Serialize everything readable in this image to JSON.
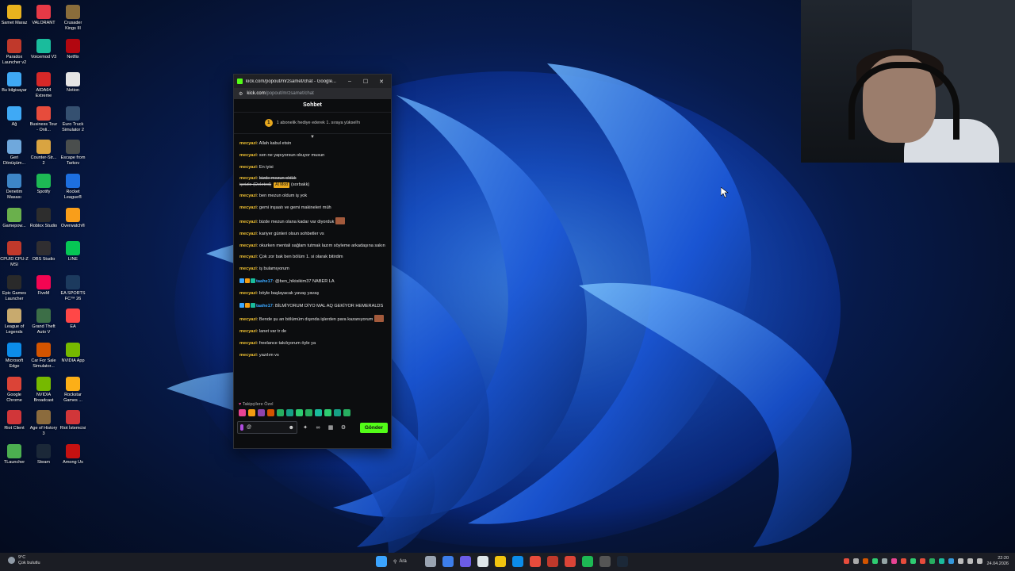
{
  "desktop": {
    "icons": [
      {
        "label": "Samet Maraz",
        "color": "#e8b21e"
      },
      {
        "label": "VALORANT",
        "color": "#e63946"
      },
      {
        "label": "Crusader Kings III",
        "color": "#8a6d3b"
      },
      {
        "label": "Paradox Launcher v2",
        "color": "#c0392b"
      },
      {
        "label": "Voicemod V3",
        "color": "#1abc9c"
      },
      {
        "label": "Netflix",
        "color": "#b20710"
      },
      {
        "label": "Bu bilgisayar",
        "color": "#3fa9f5"
      },
      {
        "label": "AIDA64 Extreme",
        "color": "#d62828"
      },
      {
        "label": "Notion",
        "color": "#e5e5e5"
      },
      {
        "label": "Ağ",
        "color": "#3fa9f5"
      },
      {
        "label": "Business Tour - Onli...",
        "color": "#e74c3c"
      },
      {
        "label": "Euro Truck Simulator 2",
        "color": "#355070"
      },
      {
        "label": "Geri Dönüşüm...",
        "color": "#6fa8dc"
      },
      {
        "label": "Counter-Str... 2",
        "color": "#d9a441"
      },
      {
        "label": "Escape from Tarkov",
        "color": "#4a4e4d"
      },
      {
        "label": "Denetim Masası",
        "color": "#3d85c6"
      },
      {
        "label": "Spotify",
        "color": "#1db954"
      },
      {
        "label": "Rocket League®",
        "color": "#1d6fe0"
      },
      {
        "label": "Gamepow...",
        "color": "#6ab04c"
      },
      {
        "label": "Roblox Studio",
        "color": "#2d2d2d"
      },
      {
        "label": "Overwatch®",
        "color": "#f99e1a"
      },
      {
        "label": "CPUID CPU-Z MSI",
        "color": "#c0392b"
      },
      {
        "label": "OBS Studio",
        "color": "#302e31"
      },
      {
        "label": "LINE",
        "color": "#06c755"
      },
      {
        "label": "Epic Games Launcher",
        "color": "#2a2a2a"
      },
      {
        "label": "FiveM",
        "color": "#f40552"
      },
      {
        "label": "EA SPORTS FC™ 26",
        "color": "#1c3a5e"
      },
      {
        "label": "League of Legends",
        "color": "#c8aa6e"
      },
      {
        "label": "Grand Theft Auto V",
        "color": "#3c6e47"
      },
      {
        "label": "EA",
        "color": "#ff4747"
      },
      {
        "label": "Microsoft Edge",
        "color": "#0c8ce9"
      },
      {
        "label": "Car For Sale Simulator...",
        "color": "#d35400"
      },
      {
        "label": "NVIDIA App",
        "color": "#76b900"
      },
      {
        "label": "Google Chrome",
        "color": "#db4437"
      },
      {
        "label": "NVIDIA Broadcast",
        "color": "#76b900"
      },
      {
        "label": "Rockstar Games ...",
        "color": "#fcaf17"
      },
      {
        "label": "Riot Client",
        "color": "#d13639"
      },
      {
        "label": "Age of History 3",
        "color": "#8b6b3d"
      },
      {
        "label": "Riot İstemcisi",
        "color": "#d13639"
      },
      {
        "label": "TLauncher",
        "color": "#4caf50"
      },
      {
        "label": "Steam",
        "color": "#1b2838"
      },
      {
        "label": "Among Us",
        "color": "#c51111"
      }
    ]
  },
  "window": {
    "title": "kick.com/popout/mrzsamet/chat - Google...",
    "controls": {
      "minimize": "–",
      "maximize": "☐",
      "close": "✕"
    },
    "url_host": "kick.com",
    "url_path": "/popout/mrzsamet/chat",
    "favicon_color": "#53fc18"
  },
  "chat": {
    "header": "Sohbet",
    "goal_badge": "1",
    "goal_text": "1 abonelik hediye ederek 1. sıraya yüksel!n",
    "pin_icon": "▼",
    "messages": [
      {
        "user": "mecyazi",
        "text": "Allah kabul etsin"
      },
      {
        "user": "mecyazi",
        "text": "sen ne yapıyorsun okuyor musun"
      },
      {
        "user": "mecyazi",
        "text": "En iyisi"
      },
      {
        "user": "mecyazi",
        "text": "bizde mezun oldük",
        "deleted": true,
        "deleted_line": "işeizle (Deleted)",
        "tag": "AI Mod",
        "tag_user": "(sorbakk)"
      },
      {
        "user": "mecyazi",
        "text": "ben mezun oldum iş yok"
      },
      {
        "user": "mecyazi",
        "text": "gemi inşaatı ve gemi makineleri müh"
      },
      {
        "user": "mecyazi",
        "text": "bizde mezun olana kadar var diyorduk",
        "emote": true
      },
      {
        "user": "mecyazi",
        "text": "kariyer günleri olsun sohbetler vs"
      },
      {
        "user": "mecyazi",
        "text": "okurken mentali sağlam tutmak lazım söyleme arkadaşına sakın"
      },
      {
        "user": "mecyazi",
        "text": "Çok zor bak ben bölüm 1. si olarak bitirdim"
      },
      {
        "user": "mecyazi",
        "text": "iş bulamıyorum"
      },
      {
        "user": "taahe17",
        "text": "@ben_hikisikim37 NABER LA",
        "badges": true
      },
      {
        "user": "mecyazi",
        "text": "böyle başlayacak yavaş yavaş"
      },
      {
        "user": "taahe17",
        "text": "BİLMİYORUM DİYO MAL AQ GEKİYOR HEMERALDS",
        "badges": true
      },
      {
        "user": "mecyazi",
        "text": "Bende şu an bölümüm dışında işlerden para kazanıyorum",
        "emote": true
      },
      {
        "user": "mecyazi",
        "text": "lanet var tr de"
      },
      {
        "user": "mecyazi",
        "text": "freelance takılıyorum öyle ya"
      },
      {
        "user": "mecyazi",
        "text": "yazılım vs"
      }
    ],
    "followers_label": "Takipçilere Özel",
    "emote_colors": [
      "#e84393",
      "#f39c12",
      "#8e44ad",
      "#d35400",
      "#27ae60",
      "#16a085",
      "#2ecc71",
      "#27ae60",
      "#1abc9c",
      "#2ecc71",
      "#16a085",
      "#27ae60"
    ],
    "input_at": "@",
    "send_label": "Gönder"
  },
  "taskbar": {
    "weather_temp": "9°C",
    "weather_desc": "Çok bulutlu",
    "search_label": "Ara",
    "apps": [
      {
        "name": "start-icon",
        "color": "#3ba4ff"
      },
      {
        "name": "task-view-icon",
        "color": "#9aa4b2"
      },
      {
        "name": "store-icon",
        "color": "#3d7eea"
      },
      {
        "name": "copilot-icon",
        "color": "#6c5ce7"
      },
      {
        "name": "notepad-icon",
        "color": "#dfe6e9"
      },
      {
        "name": "explorer-icon",
        "color": "#f1c40f"
      },
      {
        "name": "edge-icon",
        "color": "#0c8ce9"
      },
      {
        "name": "acrobat-icon",
        "color": "#e74c3c"
      },
      {
        "name": "adobe-icon",
        "color": "#c0392b"
      },
      {
        "name": "chrome-icon",
        "color": "#db4437"
      },
      {
        "name": "spotify-icon",
        "color": "#1db954"
      },
      {
        "name": "obs-icon",
        "color": "#555555"
      },
      {
        "name": "steam-icon",
        "color": "#1b2838"
      }
    ],
    "tray_colors": [
      "#e74c3c",
      "#aaaaaa",
      "#d35400",
      "#2ecc71",
      "#95a5a6",
      "#e84393",
      "#e74c3c",
      "#2ecc71",
      "#e74c3c",
      "#27ae60",
      "#1abc9c",
      "#3498db",
      "#bbbbbb",
      "#bbbbbb",
      "#bbbbbb"
    ],
    "time": "22:20",
    "date": "24.04.2026"
  }
}
